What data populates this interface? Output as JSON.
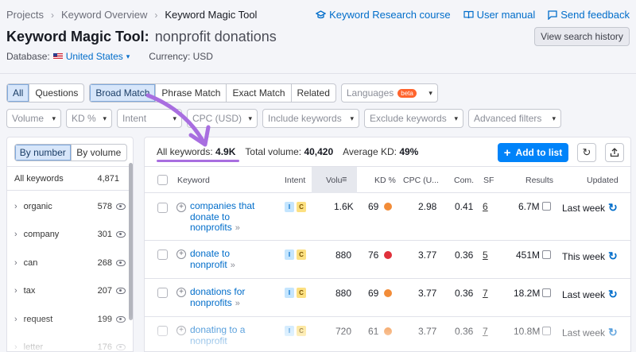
{
  "breadcrumb": {
    "items": [
      "Projects",
      "Keyword Overview",
      "Keyword Magic Tool"
    ]
  },
  "top_links": {
    "research_course": "Keyword Research course",
    "manual": "User manual",
    "feedback": "Send feedback"
  },
  "header": {
    "title": "Keyword Magic Tool:",
    "query": "nonprofit donations",
    "history_button": "View search history"
  },
  "database": {
    "label": "Database:",
    "country": "United States",
    "currency": "Currency: USD"
  },
  "match_tabs": [
    "All",
    "Questions",
    "Broad Match",
    "Phrase Match",
    "Exact Match",
    "Related"
  ],
  "languages": {
    "label": "Languages",
    "badge": "beta"
  },
  "filters": [
    "Volume",
    "KD %",
    "Intent",
    "CPC (USD)",
    "Include keywords",
    "Exclude keywords",
    "Advanced filters"
  ],
  "sidebar": {
    "toggle": [
      "By number",
      "By volume"
    ],
    "header": {
      "label": "All keywords",
      "count": "4,871"
    },
    "groups": [
      {
        "label": "organic",
        "count": "578"
      },
      {
        "label": "company",
        "count": "301"
      },
      {
        "label": "can",
        "count": "268"
      },
      {
        "label": "tax",
        "count": "207"
      },
      {
        "label": "request",
        "count": "199"
      },
      {
        "label": "letter",
        "count": "176"
      }
    ]
  },
  "summary": {
    "all_label": "All keywords:",
    "all_value": "4.9K",
    "vol_label": "Total volume:",
    "vol_value": "40,420",
    "kd_label": "Average KD:",
    "kd_value": "49%",
    "add_button": "Add to list"
  },
  "table": {
    "headers": {
      "keyword": "Keyword",
      "intent": "Intent",
      "volume": "Volu",
      "kd": "KD %",
      "cpc": "CPC (U...",
      "com": "Com.",
      "sf": "SF",
      "results": "Results",
      "updated": "Updated"
    },
    "rows": [
      {
        "keyword": [
          "companies that",
          "donate to",
          "nonprofits"
        ],
        "intent": [
          "I",
          "C"
        ],
        "volume": "1.6K",
        "kd": "69",
        "kd_color": "#f28c38",
        "cpc": "2.98",
        "com": "0.41",
        "sf": "6",
        "results": "6.7M",
        "updated": "Last week"
      },
      {
        "keyword": [
          "donate to",
          "nonprofit"
        ],
        "intent": [
          "I",
          "C"
        ],
        "volume": "880",
        "kd": "76",
        "kd_color": "#e0313b",
        "cpc": "3.77",
        "com": "0.36",
        "sf": "5",
        "results": "451M",
        "updated": "This week"
      },
      {
        "keyword": [
          "donations for",
          "nonprofits"
        ],
        "intent": [
          "I",
          "C"
        ],
        "volume": "880",
        "kd": "69",
        "kd_color": "#f28c38",
        "cpc": "3.77",
        "com": "0.36",
        "sf": "7",
        "results": "18.2M",
        "updated": "Last week"
      },
      {
        "keyword": [
          "donating to a",
          "nonprofit"
        ],
        "intent": [
          "I",
          "C"
        ],
        "volume": "720",
        "kd": "61",
        "kd_color": "#f28c38",
        "cpc": "3.77",
        "com": "0.36",
        "sf": "7",
        "results": "10.8M",
        "updated": "Last week"
      }
    ]
  },
  "colors": {
    "accent": "#006dca",
    "highlight_arrow": "#a86ee0",
    "primary_button": "#0083f9"
  }
}
